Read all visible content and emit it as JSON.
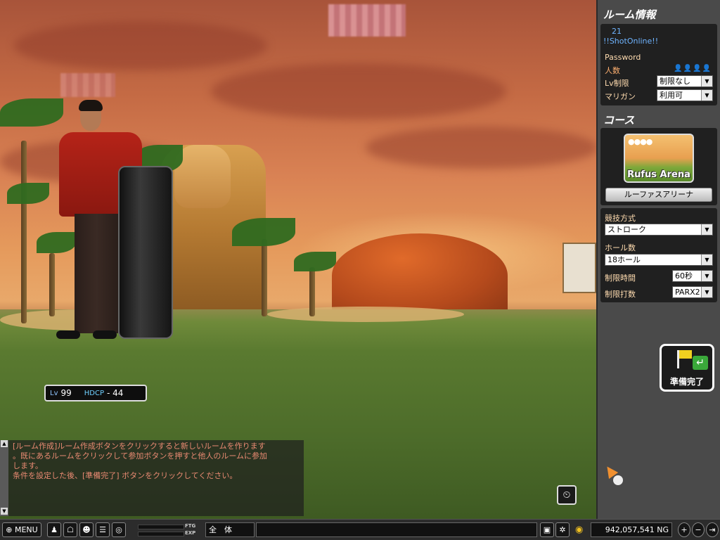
{
  "hud": {
    "level_label": "Lv",
    "level_value": "99",
    "hdcp_label": "HDCP",
    "hdcp_value": "- 44"
  },
  "chat": {
    "line1": "[ルーム作成]ルーム作成ボタンをクリックすると新しいルームを作ります",
    "line2": "。既にあるルームをクリックして参加ボタンを押すと他人のルームに参加",
    "line3": "します。",
    "line4": "条件を設定した後、[準備完了] ボタンをクリックしてください。"
  },
  "room_info": {
    "title": "ルーム情報",
    "room_number": "21",
    "room_name": "!!ShotOnline!!",
    "password_label": "Password",
    "players_label": "人数",
    "players_icons": "👤👤👤👤",
    "lv_limit_label": "Lv制限",
    "lv_limit_value": "制限なし",
    "mulligan_label": "マリガン",
    "mulligan_value": "利用可"
  },
  "course": {
    "title": "コース",
    "balls": "●●●●",
    "image_name": "Rufus Arena",
    "button_label": "ルーファスアリーナ"
  },
  "settings": {
    "mode_label": "競技方式",
    "mode_value": "ストローク",
    "holes_label": "ホール数",
    "holes_value": "18ホール",
    "time_label": "制限時間",
    "time_value": "60秒",
    "strokes_label": "制限打数",
    "strokes_value": "PARX2"
  },
  "ready_button": {
    "label": "準備完了"
  },
  "taskbar": {
    "menu_label": "MENU",
    "ftg_label": "FTG",
    "exp_label": "EXP",
    "channel_label": "全　体",
    "money_value": "942,057,541",
    "money_unit": "NG"
  },
  "colors": {
    "panel_bg": "#4a4a4a",
    "label_color": "#ffdcb0",
    "chat_text": "#e98a72",
    "room_name_color": "#6fb4ff"
  }
}
